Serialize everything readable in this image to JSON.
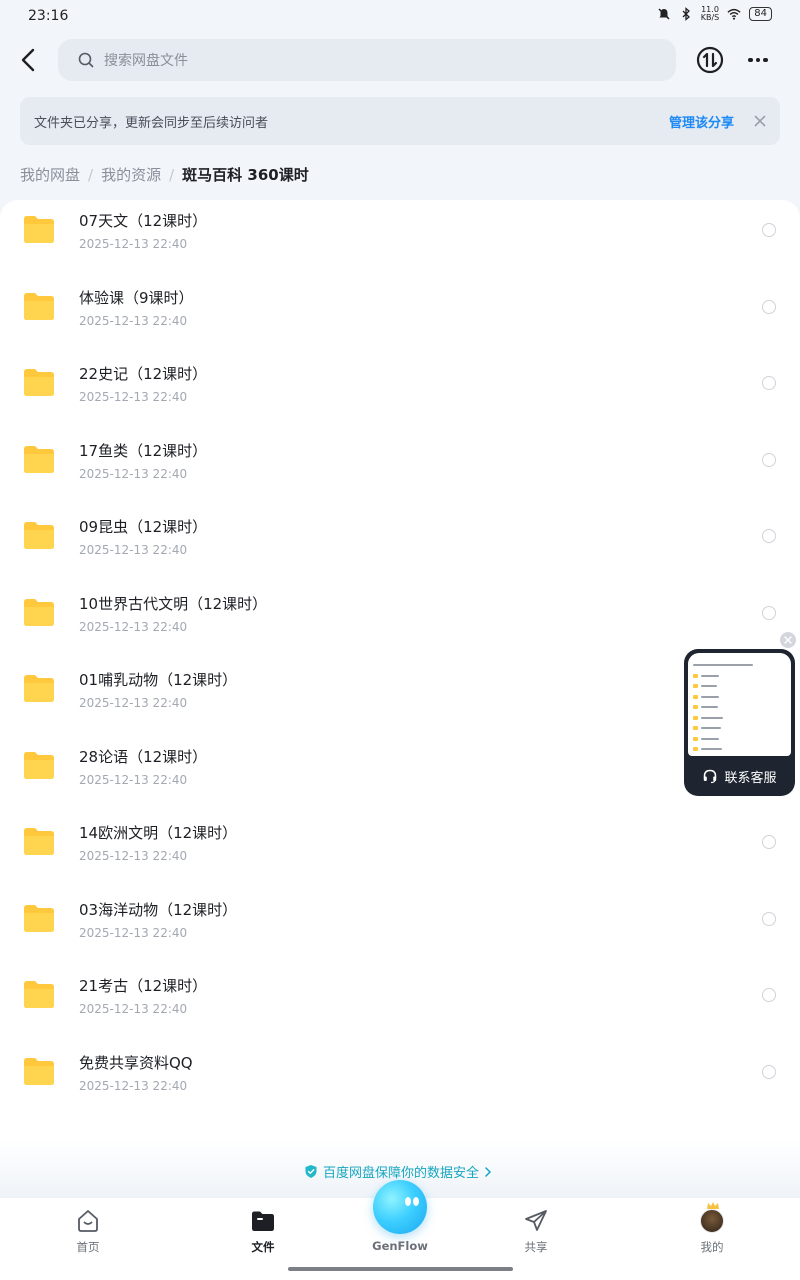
{
  "status_bar": {
    "time": "23:16",
    "net_speed_value": "11.0",
    "net_speed_unit": "KB/S",
    "battery": "84"
  },
  "header": {
    "search_placeholder": "搜索网盘文件"
  },
  "share_notice": {
    "text": "文件夹已分享，更新会同步至后续访问者",
    "manage_label": "管理该分享"
  },
  "breadcrumb": {
    "items": [
      "我的网盘",
      "我的资源"
    ],
    "current": "斑马百科 360课时"
  },
  "files": [
    {
      "name": "07天文（12课时）",
      "date": "2025-12-13  22:40"
    },
    {
      "name": "体验课（9课时）",
      "date": "2025-12-13  22:40"
    },
    {
      "name": "22史记（12课时）",
      "date": "2025-12-13  22:40"
    },
    {
      "name": "17鱼类（12课时）",
      "date": "2025-12-13  22:40"
    },
    {
      "name": "09昆虫（12课时）",
      "date": "2025-12-13  22:40"
    },
    {
      "name": "10世界古代文明（12课时）",
      "date": "2025-12-13  22:40"
    },
    {
      "name": "01哺乳动物（12课时）",
      "date": "2025-12-13  22:40"
    },
    {
      "name": "28论语（12课时）",
      "date": "2025-12-13  22:40"
    },
    {
      "name": "14欧洲文明（12课时）",
      "date": "2025-12-13  22:40"
    },
    {
      "name": "03海洋动物（12课时）",
      "date": "2025-12-13  22:40"
    },
    {
      "name": "21考古（12课时）",
      "date": "2025-12-13  22:40"
    },
    {
      "name": "免费共享资料QQ",
      "date": "2025-12-13  22:40"
    }
  ],
  "service_widget": {
    "label": "联系客服"
  },
  "security_banner": {
    "text": "百度网盘保障你的数据安全"
  },
  "bottom_nav": {
    "home": "首页",
    "files": "文件",
    "genflow": "GenFlow",
    "share": "共享",
    "mine": "我的"
  },
  "colors": {
    "accent": "#1e8af5",
    "folder": "#ffc83d",
    "security": "#16a6c0"
  }
}
